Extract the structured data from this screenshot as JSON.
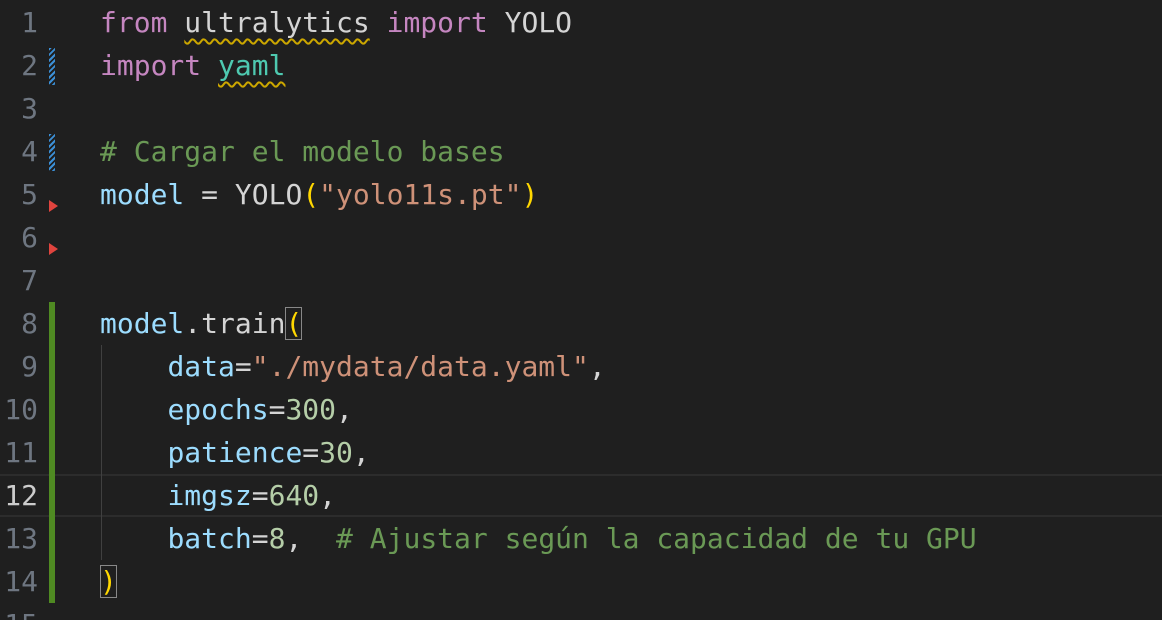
{
  "editor": {
    "lines": [
      {
        "n": "1",
        "tokens": [
          {
            "t": "from",
            "c": "kw"
          },
          {
            "t": " "
          },
          {
            "t": "ultralytics",
            "c": "fn",
            "sq": true
          },
          {
            "t": " "
          },
          {
            "t": "import",
            "c": "kw"
          },
          {
            "t": " "
          },
          {
            "t": "YOLO",
            "c": "fn"
          }
        ]
      },
      {
        "n": "2",
        "tokens": [
          {
            "t": "import",
            "c": "kw"
          },
          {
            "t": " "
          },
          {
            "t": "yaml",
            "c": "mod",
            "sq": true
          }
        ]
      },
      {
        "n": "3",
        "tokens": []
      },
      {
        "n": "4",
        "tokens": [
          {
            "t": "# Cargar el modelo bases",
            "c": "cmt"
          }
        ]
      },
      {
        "n": "5",
        "tokens": [
          {
            "t": "model",
            "c": "var"
          },
          {
            "t": " = "
          },
          {
            "t": "YOLO",
            "c": "fn"
          },
          {
            "t": "(",
            "c": "paren"
          },
          {
            "t": "\"yolo11s.pt\"",
            "c": "str"
          },
          {
            "t": ")",
            "c": "paren"
          }
        ]
      },
      {
        "n": "6",
        "tokens": []
      },
      {
        "n": "7",
        "tokens": []
      },
      {
        "n": "8",
        "tokens": [
          {
            "t": "model",
            "c": "var"
          },
          {
            "t": "."
          },
          {
            "t": "train",
            "c": "fn"
          },
          {
            "t": "(",
            "c": "paren-box"
          }
        ]
      },
      {
        "n": "9",
        "tokens": [
          {
            "t": "    "
          },
          {
            "t": "data",
            "c": "var"
          },
          {
            "t": "="
          },
          {
            "t": "\"./mydata/data.yaml\"",
            "c": "str"
          },
          {
            "t": ","
          }
        ]
      },
      {
        "n": "10",
        "tokens": [
          {
            "t": "    "
          },
          {
            "t": "epochs",
            "c": "var"
          },
          {
            "t": "="
          },
          {
            "t": "300",
            "c": "num"
          },
          {
            "t": ","
          }
        ]
      },
      {
        "n": "11",
        "tokens": [
          {
            "t": "    "
          },
          {
            "t": "patience",
            "c": "var"
          },
          {
            "t": "="
          },
          {
            "t": "30",
            "c": "num"
          },
          {
            "t": ","
          }
        ]
      },
      {
        "n": "12",
        "tokens": [
          {
            "t": "    "
          },
          {
            "t": "imgsz",
            "c": "var"
          },
          {
            "t": "="
          },
          {
            "t": "640",
            "c": "num"
          },
          {
            "t": ","
          }
        ],
        "current": true
      },
      {
        "n": "13",
        "tokens": [
          {
            "t": "    "
          },
          {
            "t": "batch",
            "c": "var"
          },
          {
            "t": "="
          },
          {
            "t": "8",
            "c": "num"
          },
          {
            "t": ",  "
          },
          {
            "t": "# Ajustar según la capacidad de tu GPU",
            "c": "cmt"
          }
        ]
      },
      {
        "n": "14",
        "tokens": [
          {
            "t": ")",
            "c": "paren-box"
          }
        ]
      },
      {
        "n": "15",
        "tokens": []
      }
    ],
    "gutter_markers": [
      {
        "line": 2,
        "type": "modified"
      },
      {
        "line": 4,
        "type": "modified"
      },
      {
        "line": 5,
        "type": "deleted"
      },
      {
        "line": 6,
        "type": "deleted"
      },
      {
        "line": 8,
        "type": "added"
      },
      {
        "line": 14,
        "type": "added"
      }
    ]
  }
}
